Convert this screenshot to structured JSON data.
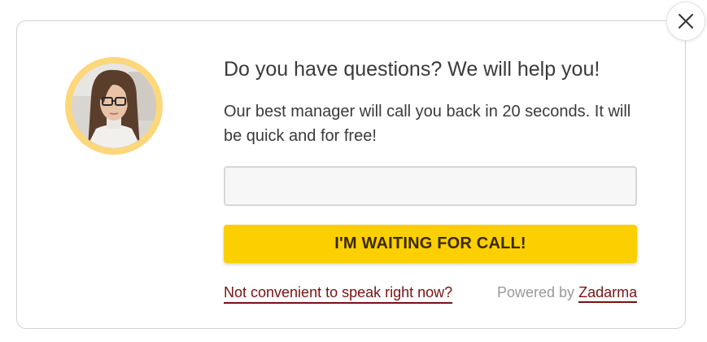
{
  "close": {
    "icon": "close-icon"
  },
  "avatar": {
    "icon": "manager-photo",
    "ring_color": "#fdd77a"
  },
  "headline": "Do you have questions? We will help you!",
  "subtext": "Our best manager will call you back in 20 seconds. It will be quick and for free!",
  "phone_input": {
    "value": "",
    "placeholder": ""
  },
  "call_button": {
    "label": "I'M WAITING FOR CALL!",
    "color": "#fccf00"
  },
  "footer": {
    "later_link": "Not convenient to speak right now?",
    "powered_by": "Powered by",
    "brand": "Zadarma",
    "link_color": "#7a1212"
  }
}
